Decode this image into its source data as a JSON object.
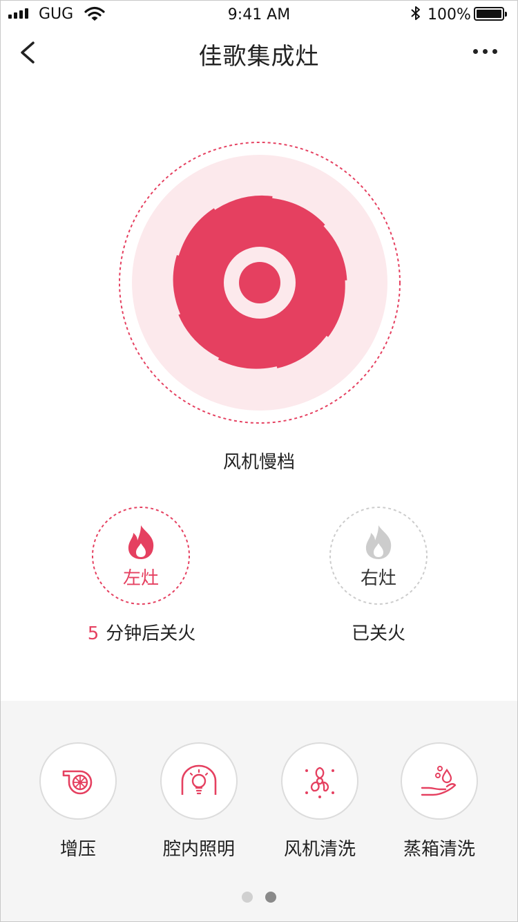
{
  "status_bar": {
    "carrier": "GUG",
    "time": "9:41 AM",
    "battery_percent": "100%",
    "icons": [
      "signal-icon",
      "wifi-icon",
      "bluetooth-icon",
      "battery-icon"
    ]
  },
  "nav": {
    "title": "佳歌集成灶",
    "back_icon": "back-arrow-icon",
    "more_icon": "more-icon"
  },
  "fan": {
    "icon": "fan-icon",
    "status": "风机慢档",
    "accent": "#e54060",
    "bg": "#fce9ec"
  },
  "burners": [
    {
      "label": "左灶",
      "timer_value": "5",
      "status": "分钟后关火",
      "state": "on",
      "icon": "flame-icon"
    },
    {
      "label": "右灶",
      "status": "已关火",
      "state": "off",
      "icon": "flame-icon"
    }
  ],
  "functions": [
    {
      "label": "增压",
      "icon": "turbo-icon"
    },
    {
      "label": "腔内照明",
      "icon": "oven-light-icon"
    },
    {
      "label": "风机清洗",
      "icon": "fan-clean-icon"
    },
    {
      "label": "蒸箱清洗",
      "icon": "steam-clean-icon"
    }
  ],
  "pagination": {
    "pages": 2,
    "current": 2
  },
  "colors": {
    "accent": "#e54060",
    "inactive": "#cccccc",
    "panel_bg": "#f5f5f5"
  }
}
